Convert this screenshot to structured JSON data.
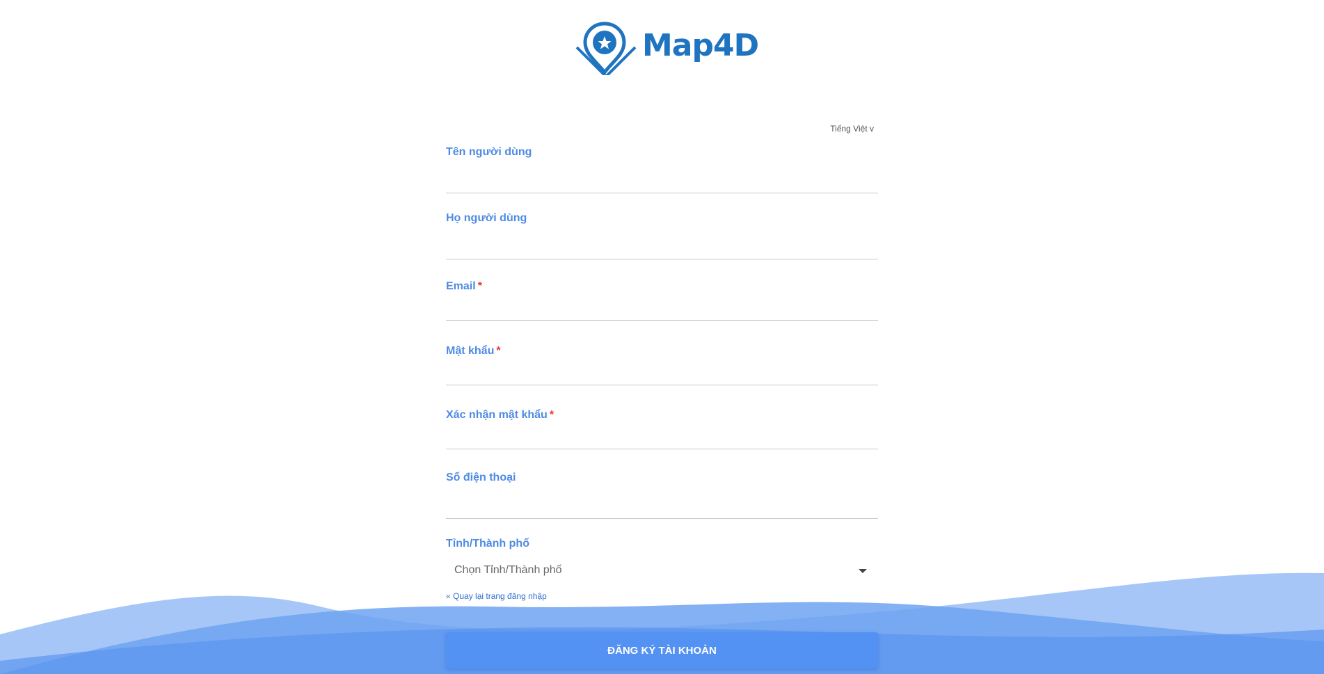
{
  "brand": {
    "name": "Map4D",
    "color": "#1f74c0"
  },
  "language": {
    "label": "Tiếng Việt",
    "caret": "v"
  },
  "form": {
    "first_name": {
      "label": "Tên người dùng",
      "value": ""
    },
    "last_name": {
      "label": "Họ người dùng",
      "value": ""
    },
    "email": {
      "label": "Email",
      "required_mark": "*",
      "value": ""
    },
    "password": {
      "label": "Mật khẩu",
      "required_mark": "*",
      "value": ""
    },
    "confirm_password": {
      "label": "Xác nhận mật khẩu",
      "required_mark": "*",
      "value": ""
    },
    "phone": {
      "label": "Số điện thoại",
      "value": ""
    },
    "province": {
      "label": "Tỉnh/Thành phố",
      "selected": "Chọn Tỉnh/Thành phố"
    }
  },
  "back_link": "« Quay lại trang đăng nhập",
  "submit_label": "ĐĂNG KÝ TÀI KHOẢN",
  "colors": {
    "label": "#4d8ae3",
    "required": "#e53935",
    "button": "#5391f3",
    "wave_light": "#9dc0f7",
    "wave_mid": "#6fa3f2"
  }
}
